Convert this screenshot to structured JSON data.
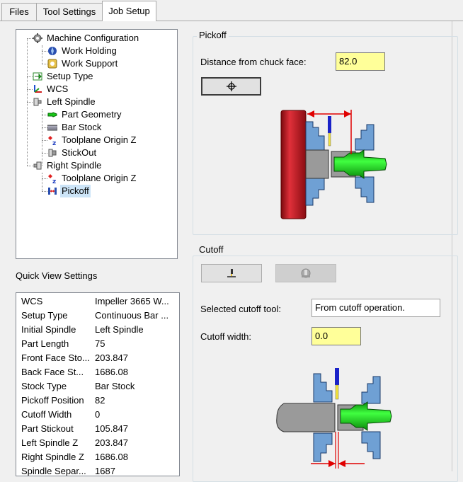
{
  "tabs": [
    {
      "label": "Files"
    },
    {
      "label": "Tool Settings"
    },
    {
      "label": "Job Setup"
    }
  ],
  "active_tab": "Job Setup",
  "tree": {
    "machine_configuration": "Machine Configuration",
    "work_holding": "Work Holding",
    "work_support": "Work Support",
    "setup_type": "Setup Type",
    "wcs": "WCS",
    "left_spindle": "Left Spindle",
    "part_geometry": "Part Geometry",
    "bar_stock": "Bar Stock",
    "toolplane_origin_z_left": "Toolplane Origin Z",
    "stickout": "StickOut",
    "right_spindle": "Right Spindle",
    "toolplane_origin_z_right": "Toolplane Origin Z",
    "pickoff": "Pickoff",
    "selected": "Pickoff"
  },
  "quick_view": {
    "title": "Quick View Settings",
    "rows": [
      {
        "key": "WCS",
        "value": "Impeller 3665 W..."
      },
      {
        "key": "Setup Type",
        "value": "Continuous Bar ..."
      },
      {
        "key": "Initial Spindle",
        "value": "Left Spindle"
      },
      {
        "key": "Part Length",
        "value": "75"
      },
      {
        "key": "Front Face Sto...",
        "value": "203.847"
      },
      {
        "key": "Back Face St...",
        "value": "1686.08"
      },
      {
        "key": "Stock Type",
        "value": "Bar Stock"
      },
      {
        "key": "Pickoff Position",
        "value": "82"
      },
      {
        "key": "Cutoff Width",
        "value": "0"
      },
      {
        "key": "Part Stickout",
        "value": "105.847"
      },
      {
        "key": "Left Spindle Z",
        "value": "203.847"
      },
      {
        "key": "Right Spindle Z",
        "value": "1686.08"
      },
      {
        "key": "Spindle Separ...",
        "value": "1687"
      }
    ]
  },
  "pickoff": {
    "title": "Pickoff",
    "distance_label": "Distance from chuck face:",
    "distance_value": "82.0",
    "select_button_icon": "crosshair-icon"
  },
  "cutoff": {
    "title": "Cutoff",
    "cutoff_tool_button_icon": "cutoff-tool-icon",
    "disabled_button_icon": "tool-select-icon",
    "selected_tool_label": "Selected cutoff tool:",
    "selected_tool_value": "From cutoff operation.",
    "width_label": "Cutoff width:",
    "width_value": "0.0"
  },
  "colors": {
    "field_yellow": "#ffff99",
    "selection": "#cce4f7",
    "chuck_red": "#c0161c",
    "jaw_blue": "#6fa0d4",
    "part_green": "#14d414",
    "arrow_red": "#e00000"
  }
}
